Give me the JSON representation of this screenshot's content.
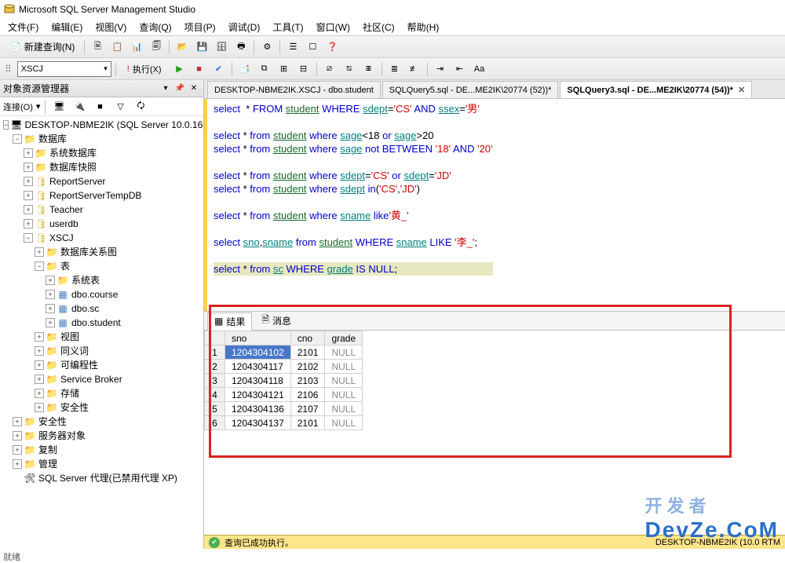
{
  "app": {
    "title": "Microsoft SQL Server Management Studio"
  },
  "menu": [
    "文件(F)",
    "编辑(E)",
    "视图(V)",
    "查询(Q)",
    "项目(P)",
    "调试(D)",
    "工具(T)",
    "窗口(W)",
    "社区(C)",
    "帮助(H)"
  ],
  "toolbar": {
    "new_query": "新建查询(N)",
    "database_selected": "XSCJ",
    "execute": "执行(X)"
  },
  "object_explorer": {
    "title": "对象资源管理器",
    "connect_label": "连接(O)",
    "server": "DESKTOP-NBME2IK (SQL Server 10.0.160",
    "nodes": {
      "databases": "数据库",
      "sys_databases": "系统数据库",
      "db_snapshots": "数据库快照",
      "report_server": "ReportServer",
      "report_server_tmp": "ReportServerTempDB",
      "teacher": "Teacher",
      "userdb": "userdb",
      "xscj": "XSCJ",
      "db_diagrams": "数据库关系图",
      "tables": "表",
      "sys_tables": "系统表",
      "dbo_course": "dbo.course",
      "dbo_sc": "dbo.sc",
      "dbo_student": "dbo.student",
      "views": "视图",
      "synonyms": "同义词",
      "programmability": "可编程性",
      "service_broker": "Service Broker",
      "storage": "存储",
      "db_security": "安全性",
      "security": "安全性",
      "server_objects": "服务器对象",
      "replication": "复制",
      "management": "管理",
      "agent": "SQL Server 代理(已禁用代理 XP)"
    }
  },
  "tabs": [
    {
      "label": "DESKTOP-NBME2IK.XSCJ - dbo.student",
      "active": false
    },
    {
      "label": "SQLQuery5.sql - DE...ME2IK\\20774 (52))*",
      "active": false
    },
    {
      "label": "SQLQuery3.sql - DE...ME2IK\\20774 (54))*",
      "active": true
    }
  ],
  "sql_lines": [
    [
      [
        "kw",
        "select"
      ],
      [
        "",
        "  * "
      ],
      [
        "kw",
        "FROM"
      ],
      [
        "",
        " "
      ],
      [
        "sq",
        "student"
      ],
      [
        "",
        " "
      ],
      [
        "kw",
        "WHERE"
      ],
      [
        "",
        " "
      ],
      [
        "uid",
        "sdept"
      ],
      [
        "",
        "="
      ],
      [
        "str",
        "'CS'"
      ],
      [
        "",
        " "
      ],
      [
        "kw",
        "AND"
      ],
      [
        "",
        " "
      ],
      [
        "uid",
        "ssex"
      ],
      [
        "",
        "="
      ],
      [
        "str",
        "'男'"
      ]
    ],
    [],
    [
      [
        "kw",
        "select"
      ],
      [
        "",
        " * "
      ],
      [
        "kw",
        "from"
      ],
      [
        "",
        " "
      ],
      [
        "sq",
        "student"
      ],
      [
        "",
        " "
      ],
      [
        "kw",
        "where"
      ],
      [
        "",
        " "
      ],
      [
        "uid",
        "sage"
      ],
      [
        "",
        "<18 "
      ],
      [
        "kw",
        "or"
      ],
      [
        "",
        " "
      ],
      [
        "uid",
        "sage"
      ],
      [
        "",
        ">20"
      ]
    ],
    [
      [
        "kw",
        "select"
      ],
      [
        "",
        " * "
      ],
      [
        "kw",
        "from"
      ],
      [
        "",
        " "
      ],
      [
        "sq",
        "student"
      ],
      [
        "",
        " "
      ],
      [
        "kw",
        "where"
      ],
      [
        "",
        " "
      ],
      [
        "uid",
        "sage"
      ],
      [
        "",
        " "
      ],
      [
        "kw",
        "not"
      ],
      [
        "",
        " "
      ],
      [
        "kw",
        "BETWEEN"
      ],
      [
        "",
        " "
      ],
      [
        "str",
        "'18'"
      ],
      [
        "",
        " "
      ],
      [
        "kw",
        "AND"
      ],
      [
        "",
        " "
      ],
      [
        "str",
        "'20'"
      ]
    ],
    [],
    [
      [
        "kw",
        "select"
      ],
      [
        "",
        " * "
      ],
      [
        "kw",
        "from"
      ],
      [
        "",
        " "
      ],
      [
        "sq",
        "student"
      ],
      [
        "",
        " "
      ],
      [
        "kw",
        "where"
      ],
      [
        "",
        " "
      ],
      [
        "uid",
        "sdept"
      ],
      [
        "",
        "="
      ],
      [
        "str",
        "'CS'"
      ],
      [
        "",
        " "
      ],
      [
        "kw",
        "or"
      ],
      [
        "",
        " "
      ],
      [
        "uid",
        "sdept"
      ],
      [
        "",
        "="
      ],
      [
        "str",
        "'JD'"
      ]
    ],
    [
      [
        "kw",
        "select"
      ],
      [
        "",
        " * "
      ],
      [
        "kw",
        "from"
      ],
      [
        "",
        " "
      ],
      [
        "sq",
        "student"
      ],
      [
        "",
        " "
      ],
      [
        "kw",
        "where"
      ],
      [
        "",
        " "
      ],
      [
        "uid",
        "sdept"
      ],
      [
        "",
        " "
      ],
      [
        "kw",
        "in"
      ],
      [
        "",
        "("
      ],
      [
        "str",
        "'CS'"
      ],
      [
        "",
        ","
      ],
      [
        "str",
        "'JD'"
      ],
      [
        "",
        ")"
      ]
    ],
    [],
    [
      [
        "kw",
        "select"
      ],
      [
        "",
        " * "
      ],
      [
        "kw",
        "from"
      ],
      [
        "",
        " "
      ],
      [
        "sq",
        "student"
      ],
      [
        "",
        " "
      ],
      [
        "kw",
        "where"
      ],
      [
        "",
        " "
      ],
      [
        "uid",
        "sname"
      ],
      [
        "",
        " "
      ],
      [
        "kw",
        "like"
      ],
      [
        "str",
        "'黄_'"
      ]
    ],
    [],
    [
      [
        "kw",
        "select"
      ],
      [
        "",
        " "
      ],
      [
        "uid",
        "sno"
      ],
      [
        "",
        ","
      ],
      [
        "uid",
        "sname"
      ],
      [
        "",
        " "
      ],
      [
        "kw",
        "from"
      ],
      [
        "",
        " "
      ],
      [
        "sq",
        "student"
      ],
      [
        "",
        " "
      ],
      [
        "kw",
        "WHERE"
      ],
      [
        "",
        " "
      ],
      [
        "uid",
        "sname"
      ],
      [
        "",
        " "
      ],
      [
        "kw",
        "LIKE"
      ],
      [
        "",
        " "
      ],
      [
        "str",
        "'李_'"
      ],
      [
        "",
        ";"
      ]
    ],
    [],
    [
      [
        "hl",
        ""
      ],
      [
        "kw",
        "select"
      ],
      [
        "",
        " * "
      ],
      [
        "kw",
        "from"
      ],
      [
        "",
        " "
      ],
      [
        "uid",
        "sc"
      ],
      [
        "",
        " "
      ],
      [
        "kw",
        "WHERE"
      ],
      [
        "",
        " "
      ],
      [
        "uid",
        "grade"
      ],
      [
        "",
        " "
      ],
      [
        "kw",
        "IS"
      ],
      [
        "",
        " "
      ],
      [
        "kw",
        "NULL"
      ],
      [
        "",
        ";"
      ]
    ]
  ],
  "results": {
    "tab_results": "结果",
    "tab_messages": "消息",
    "columns": [
      "sno",
      "cno",
      "grade"
    ],
    "rows": [
      [
        "1204304102",
        "2101",
        "NULL"
      ],
      [
        "1204304117",
        "2102",
        "NULL"
      ],
      [
        "1204304118",
        "2103",
        "NULL"
      ],
      [
        "1204304121",
        "2106",
        "NULL"
      ],
      [
        "1204304136",
        "2107",
        "NULL"
      ],
      [
        "1204304137",
        "2101",
        "NULL"
      ]
    ]
  },
  "status": {
    "message": "查询已成功执行。",
    "server_info": "DESKTOP-NBME2IK (10.0 RTM"
  },
  "bottom_hint": "就绪",
  "watermark": "DevZe.CoM",
  "watermark_top": "开发者"
}
